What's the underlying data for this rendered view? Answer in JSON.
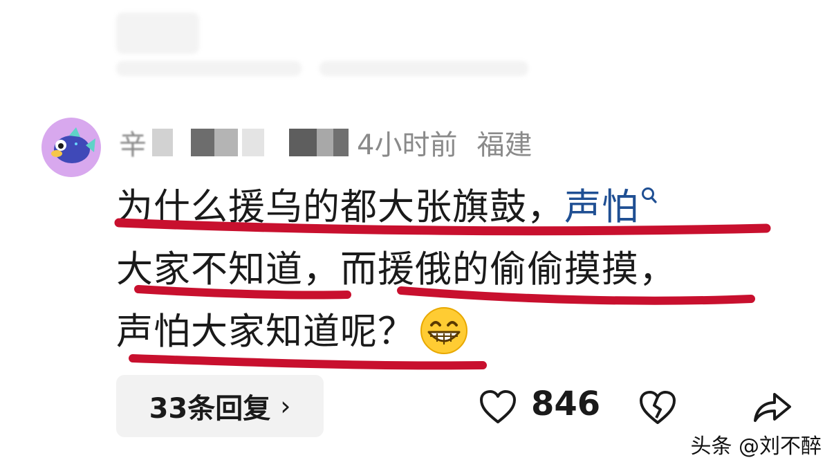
{
  "comment": {
    "username_visible": "辛",
    "time": "4小时前",
    "location": "福建",
    "text_line1": "为什么援乌的都大张旗鼓，",
    "text_link": "声怕",
    "text_line2": "大家不知道，而援俄的偷偷摸摸，",
    "text_line3": "声怕大家知道呢？",
    "replies_label": "33条回复",
    "likes": "846"
  },
  "icons": {
    "avatar": "pufferfish-avatar",
    "search": "search-icon",
    "emoji": "grinning-emoji",
    "like": "heart-icon",
    "dislike": "broken-heart-icon",
    "share": "share-icon"
  },
  "colors": {
    "link": "#1f4f93",
    "underline": "#c8102e",
    "avatar_bg": "#d8a8ee"
  },
  "watermark": "头条 @刘不醉"
}
